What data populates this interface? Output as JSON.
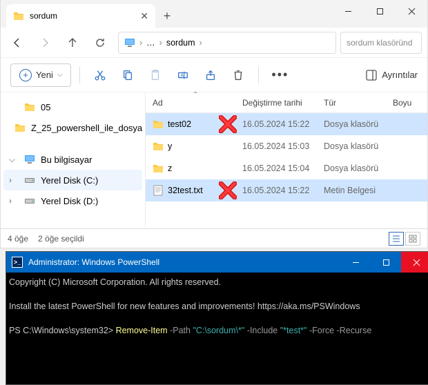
{
  "explorer": {
    "tabTitle": "sordum",
    "breadcrumb": {
      "dots": "…",
      "folder": "sordum"
    },
    "searchPlaceholder": "sordum klasöründ",
    "newLabel": "Yeni",
    "detailsLabel": "Ayrıntılar",
    "sidebar": {
      "items": [
        {
          "label": "05",
          "icon": "folder"
        },
        {
          "label": "Z_25_powershell_ile_dosya",
          "icon": "folder"
        }
      ],
      "thisPC": "Bu bilgisayar",
      "drives": [
        {
          "label": "Yerel Disk (C:)"
        },
        {
          "label": "Yerel Disk (D:)"
        }
      ]
    },
    "columns": {
      "name": "Ad",
      "modified": "Değiştirme tarihi",
      "type": "Tür",
      "size": "Boyu"
    },
    "rows": [
      {
        "name": "test02",
        "date": "16.05.2024 15:22",
        "type": "Dosya klasörü",
        "icon": "folder",
        "sel": true,
        "mark": true
      },
      {
        "name": "y",
        "date": "16.05.2024 15:03",
        "type": "Dosya klasörü",
        "icon": "folder",
        "sel": false,
        "mark": false
      },
      {
        "name": "z",
        "date": "16.05.2024 15:04",
        "type": "Dosya klasörü",
        "icon": "folder",
        "sel": false,
        "mark": false
      },
      {
        "name": "32test.txt",
        "date": "16.05.2024 15:22",
        "type": "Metin Belgesi",
        "icon": "txt",
        "sel": true,
        "mark": true
      }
    ],
    "status": {
      "count": "4 öğe",
      "selected": "2 öğe seçildi"
    }
  },
  "ps": {
    "title": "Administrator: Windows PowerShell",
    "line1": "Copyright (C) Microsoft Corporation. All rights reserved.",
    "line2": "Install the latest PowerShell for new features and improvements! https://aka.ms/PSWindows",
    "prompt": "PS C:\\Windows\\system32> ",
    "cmd": "Remove-Item",
    "p1": " -Path ",
    "s1": "\"C:\\sordum\\*\"",
    "p2": " -Include ",
    "s2": "\"*test*\"",
    "p3": " -Force -Recurse"
  }
}
